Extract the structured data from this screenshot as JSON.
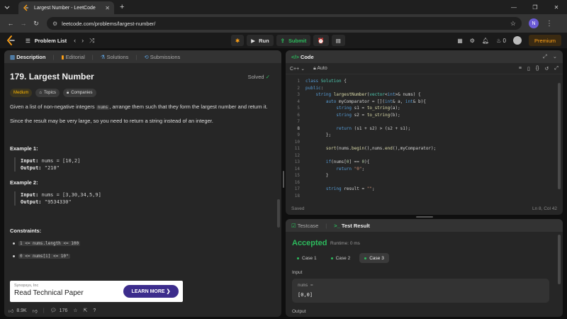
{
  "browser": {
    "tab_title": "Largest Number - LeetCode",
    "url": "leetcode.com/problems/largest-number/",
    "profile_initial": "N"
  },
  "lcnav": {
    "problem_list": "Problem List",
    "run": "Run",
    "submit": "Submit",
    "streak": "0",
    "premium": "Premium"
  },
  "desc_tabs": [
    "Description",
    "Editorial",
    "Solutions",
    "Submissions"
  ],
  "problem": {
    "title": "179. Largest Number",
    "status": "Solved",
    "difficulty": "Medium",
    "topics": "Topics",
    "companies": "Companies",
    "p1_a": "Given a list of non-negative integers ",
    "p1_code": "nums",
    "p1_b": ", arrange them such that they form the largest number and return it.",
    "p2": "Since the result may be very large, so you need to return a string instead of an integer.",
    "ex1_title": "Example 1:",
    "ex1_input_label": "Input:",
    "ex1_input": "nums = [10,2]",
    "ex1_output_label": "Output:",
    "ex1_output": "\"210\"",
    "ex2_title": "Example 2:",
    "ex2_input_label": "Input:",
    "ex2_input": "nums = [3,30,34,5,9]",
    "ex2_output_label": "Output:",
    "ex2_output": "\"9534330\"",
    "constraints_title": "Constraints:",
    "c1": "1 <= nums.length <= 100",
    "c2": "0 <= nums[i] <= 10⁹"
  },
  "ad": {
    "sponsor": "Synopsys, Inc",
    "headline": "Read Technical Paper",
    "cta": "LEARN MORE"
  },
  "desc_footer": {
    "likes": "8.9K",
    "comments": "176"
  },
  "code_panel": {
    "title": "Code",
    "language": "C++",
    "mode": "Auto",
    "saved": "Saved",
    "cursor": "Ln 8, Col 42"
  },
  "code_lines": [
    "1",
    "2",
    "3",
    "4",
    "5",
    "6",
    "7",
    "8",
    "9",
    "10",
    "11",
    "12",
    "13",
    "14",
    "15",
    "16",
    "17",
    "18"
  ],
  "result_panel": {
    "tab_testcase": "Testcase",
    "tab_result": "Test Result",
    "status": "Accepted",
    "runtime": "Runtime: 0 ms",
    "cases": [
      "Case 1",
      "Case 2",
      "Case 3"
    ],
    "input_label": "Input",
    "input_key": "nums =",
    "input_value": "[0,0]",
    "output_label": "Output"
  },
  "colors": {
    "accepted": "#2cbb5d",
    "premium": "#ffa116",
    "medium": "#ffb800"
  }
}
